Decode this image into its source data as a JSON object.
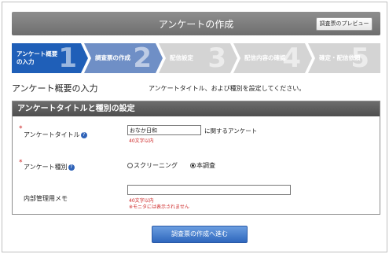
{
  "header": {
    "title": "アンケートの作成",
    "preview_button": "調査票のプレビュー"
  },
  "steps": [
    {
      "label_line1": "アンケート概要",
      "label_line2": "の入力",
      "number": "1",
      "active": true
    },
    {
      "label_line1": "調査票の作成",
      "label_line2": "",
      "number": "2",
      "active": false
    },
    {
      "label_line1": "配信設定",
      "label_line2": "",
      "number": "3",
      "active": false
    },
    {
      "label_line1": "配信内容の確認",
      "label_line2": "",
      "number": "4",
      "active": false
    },
    {
      "label_line1": "確定・配信依頼",
      "label_line2": "",
      "number": "5",
      "active": false
    }
  ],
  "colors": {
    "step_active": "#1f5fb8",
    "step_current": "#6f8fc6",
    "step_inactive": "#d4d4d4",
    "accent_red": "#cc2222"
  },
  "section": {
    "title": "アンケート概要の入力",
    "description": "アンケートタイトル、および種別を設定してください。"
  },
  "panel": {
    "heading": "アンケートタイトルと種別の設定",
    "title_field": {
      "label": "アンケートタイトル",
      "value": "おなか日和",
      "suffix": "に関するアンケート",
      "hint": "40文字以内"
    },
    "type_field": {
      "label": "アンケート種別",
      "options": [
        "スクリーニング",
        "本調査"
      ],
      "selected": "本調査"
    },
    "memo_field": {
      "label": "内部管理用メモ",
      "value": "",
      "hint": "40文字以内",
      "note": "※モニタには表示されません"
    }
  },
  "submit_button": "調査票の作成へ進む",
  "icons": {
    "help": "question-help-icon"
  }
}
